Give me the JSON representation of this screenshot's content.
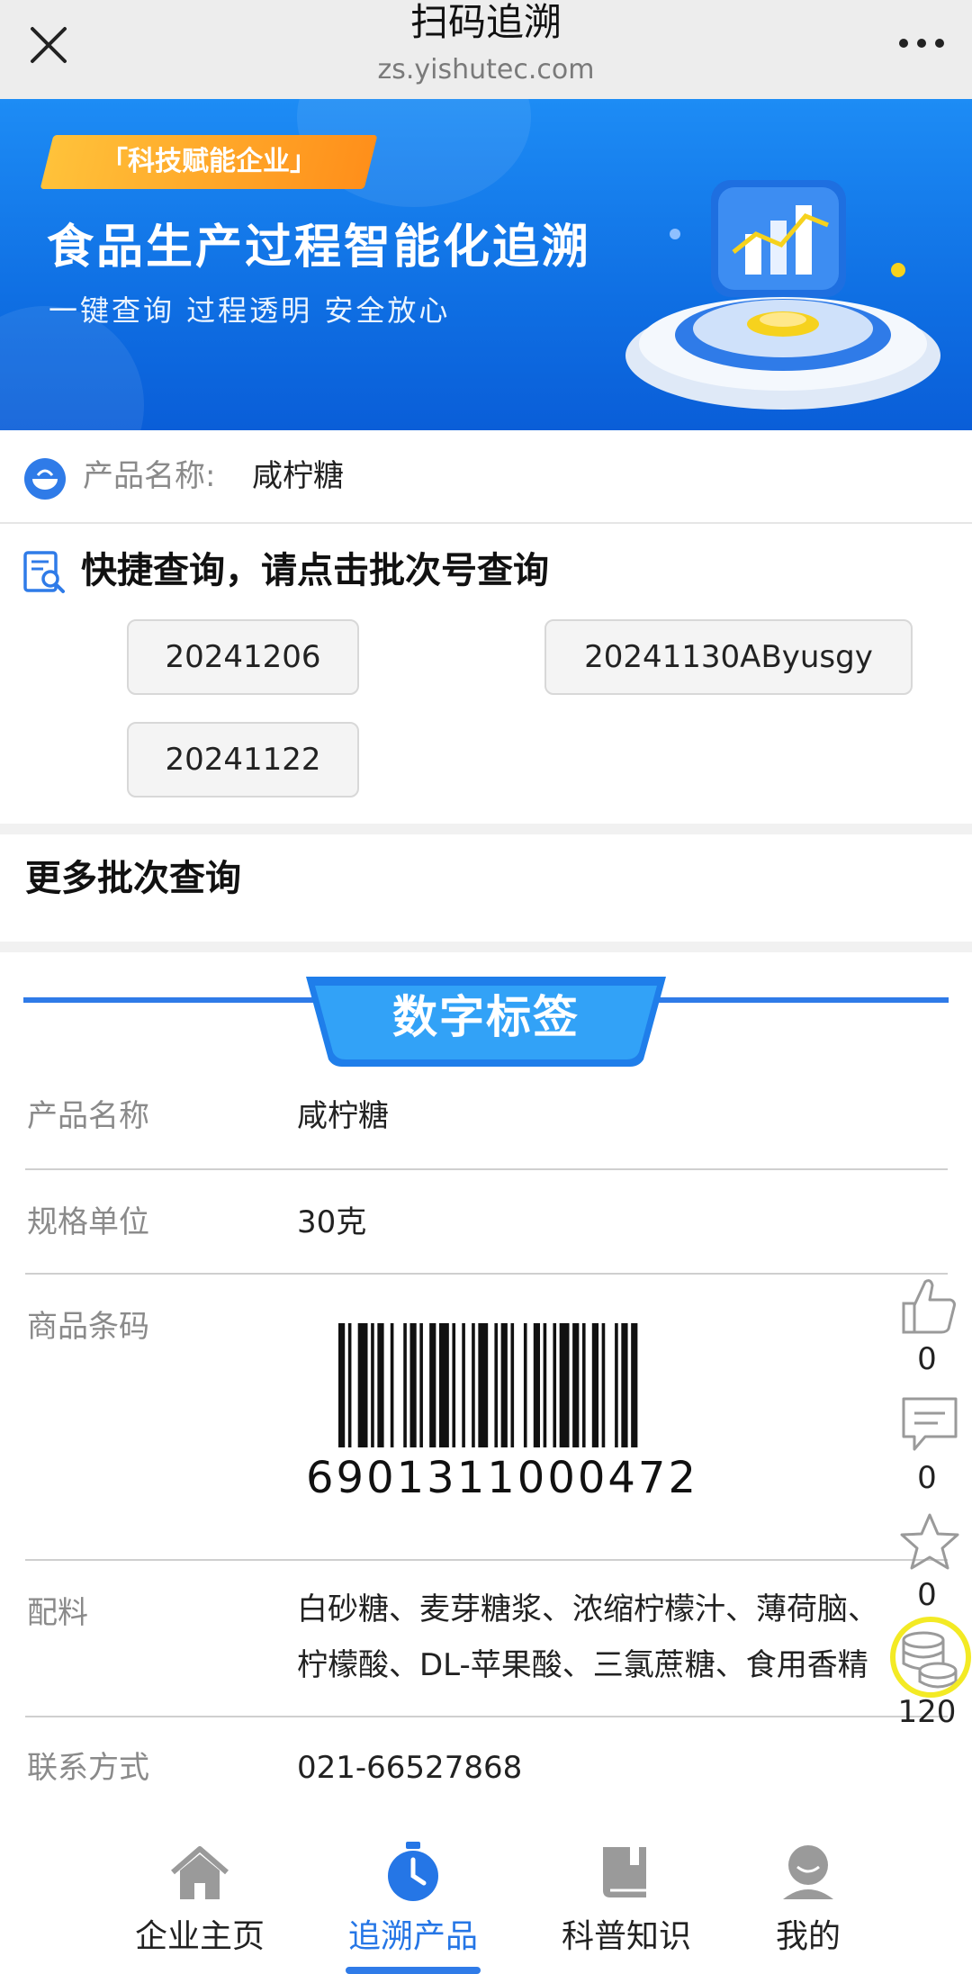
{
  "topbar": {
    "title": "扫码追溯",
    "url": "zs.yishutec.com"
  },
  "banner": {
    "tag": "「科技赋能企业」",
    "title": "食品生产过程智能化追溯",
    "subtitle": "一键查询  过程透明  安全放心"
  },
  "product": {
    "label": "产品名称:",
    "name": "咸柠糖"
  },
  "quick_query": {
    "title": "快捷查询，请点击批次号查询",
    "batches": [
      "20241206",
      "20241130AByusgy",
      "20241122"
    ]
  },
  "more_batches": "更多批次查询",
  "digital_label": {
    "title": "数字标签",
    "rows": [
      {
        "label": "产品名称",
        "value": "咸柠糖"
      },
      {
        "label": "规格单位",
        "value": "30克"
      },
      {
        "label": "商品条码",
        "value": "6901311000472"
      },
      {
        "label": "配料",
        "value_line1": "白砂糖、麦芽糖浆、浓缩柠檬汁、薄荷脑、",
        "value_line2": "柠檬酸、DL-苹果酸、三氯蔗糖、食用香精"
      },
      {
        "label": "联系方式",
        "value": "021-66527868"
      }
    ]
  },
  "floating_actions": [
    {
      "icon": "thumbs-up-icon",
      "count": "0"
    },
    {
      "icon": "comment-icon",
      "count": "0"
    },
    {
      "icon": "star-icon",
      "count": "0"
    },
    {
      "icon": "coins-icon",
      "count": "120"
    }
  ],
  "bottom_nav": [
    {
      "label": "企业主页",
      "icon": "home-icon",
      "active": false
    },
    {
      "label": "追溯产品",
      "icon": "stopwatch-icon",
      "active": true
    },
    {
      "label": "科普知识",
      "icon": "book-icon",
      "active": false
    },
    {
      "label": "我的",
      "icon": "user-icon",
      "active": false
    }
  ],
  "colors": {
    "accent": "#2576e6",
    "banner_blue": "#0f6fe3",
    "highlight_ring": "#f3ea24"
  }
}
